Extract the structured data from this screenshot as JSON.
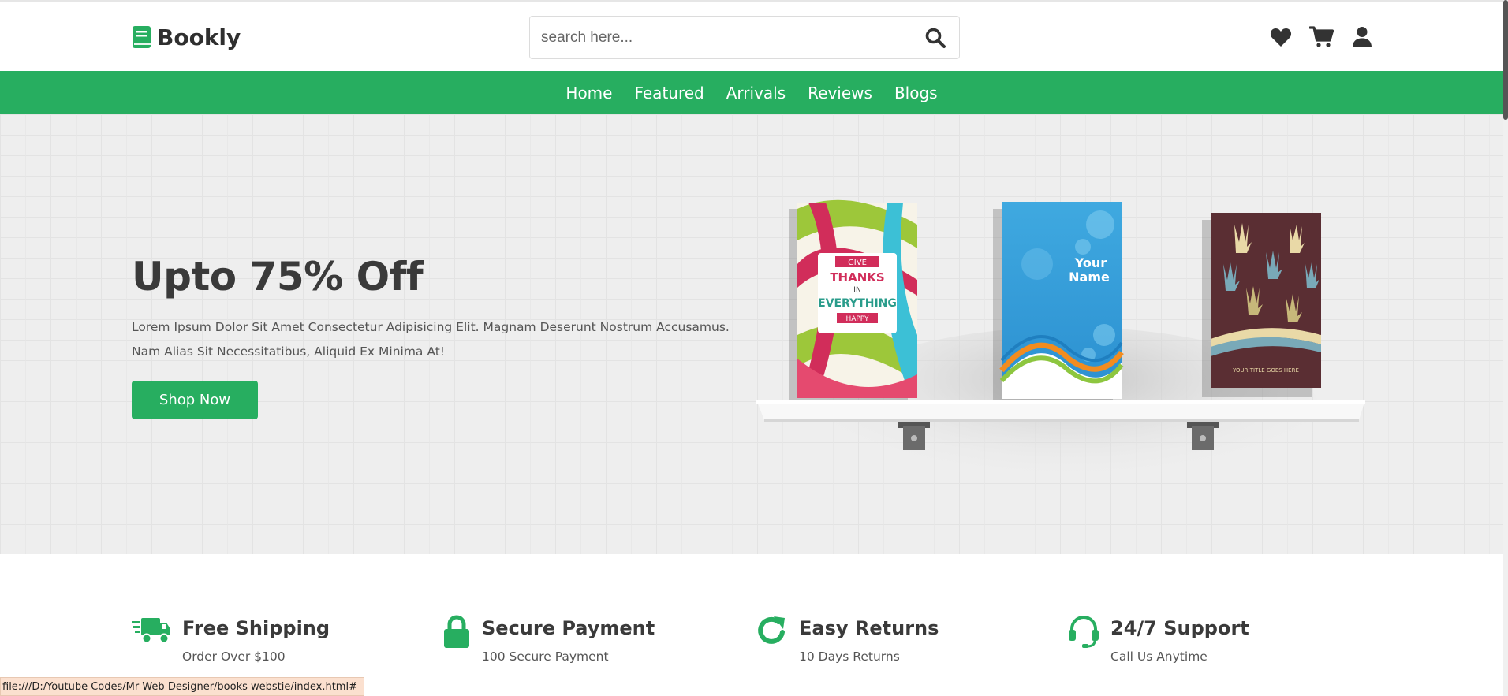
{
  "header": {
    "logo_text": "Bookly",
    "search_placeholder": "search here..."
  },
  "nav": {
    "items": [
      "Home",
      "Featured",
      "Arrivals",
      "Reviews",
      "Blogs"
    ]
  },
  "hero": {
    "title": "Upto 75% Off",
    "description": "Lorem Ipsum Dolor Sit Amet Consectetur Adipisicing Elit. Magnam Deserunt Nostrum Accusamus. Nam Alias Sit Necessitatibus, Aliquid Ex Minima At!",
    "button_label": "Shop Now",
    "book1": {
      "line1": "GIVE",
      "line2": "THANKS",
      "line3": "IN",
      "line4": "EVERYTHING",
      "line5": "HAPPY"
    },
    "book2": {
      "line1": "Your",
      "line2": "Name"
    },
    "book3": {
      "line1": "YOUR TITLE GOES HERE"
    }
  },
  "features": [
    {
      "title": "Free Shipping",
      "subtitle": "Order Over $100",
      "icon": "truck-icon"
    },
    {
      "title": "Secure Payment",
      "subtitle": "100 Secure Payment",
      "icon": "lock-icon"
    },
    {
      "title": "Easy Returns",
      "subtitle": "10 Days Returns",
      "icon": "redo-icon"
    },
    {
      "title": "24/7 Support",
      "subtitle": "Call Us Anytime",
      "icon": "headset-icon"
    }
  ],
  "status_bar": {
    "url": "file:///D:/Youtube Codes/Mr Web Designer/books webstie/index.html#"
  },
  "colors": {
    "brand_green": "#27ae60",
    "dark_text": "#3a3a3a"
  }
}
